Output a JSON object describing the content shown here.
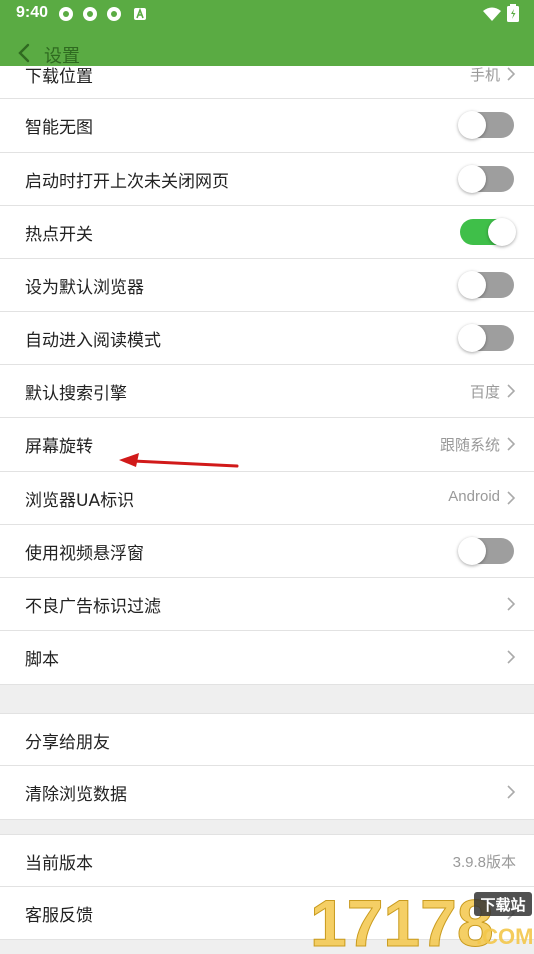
{
  "status_bar": {
    "time": "9:40"
  },
  "header": {
    "title": "设置"
  },
  "rows": [
    {
      "label": "下载位置",
      "value": "手机",
      "type": "nav"
    },
    {
      "label": "智能无图",
      "type": "toggle",
      "on": false
    },
    {
      "label": "启动时打开上次未关闭网页",
      "type": "toggle",
      "on": false
    },
    {
      "label": "热点开关",
      "type": "toggle",
      "on": true
    },
    {
      "label": "设为默认浏览器",
      "type": "toggle",
      "on": false
    },
    {
      "label": "自动进入阅读模式",
      "type": "toggle",
      "on": false
    },
    {
      "label": "默认搜索引擎",
      "value": "百度",
      "type": "nav"
    },
    {
      "label": "屏幕旋转",
      "value": "跟随系统",
      "type": "nav"
    },
    {
      "label": "浏览器UA标识",
      "value": "Android",
      "type": "nav"
    },
    {
      "label": "使用视频悬浮窗",
      "type": "toggle",
      "on": false
    },
    {
      "label": "不良广告标识过滤",
      "type": "nav"
    },
    {
      "label": "脚本",
      "type": "nav"
    },
    {
      "label": "分享给朋友",
      "type": "plain"
    },
    {
      "label": "清除浏览数据",
      "type": "nav"
    },
    {
      "label": "当前版本",
      "value": "3.9.8版本",
      "type": "info"
    },
    {
      "label": "客服反馈",
      "type": "nav"
    }
  ],
  "watermark": {
    "text": "17178",
    "badge": "下载站",
    "domain": ".COM"
  },
  "colors": {
    "header": "#5aab43",
    "toggle_on": "#3fbf49",
    "toggle_off": "#9e9e9e",
    "annotation_arrow": "#d11a1a"
  }
}
